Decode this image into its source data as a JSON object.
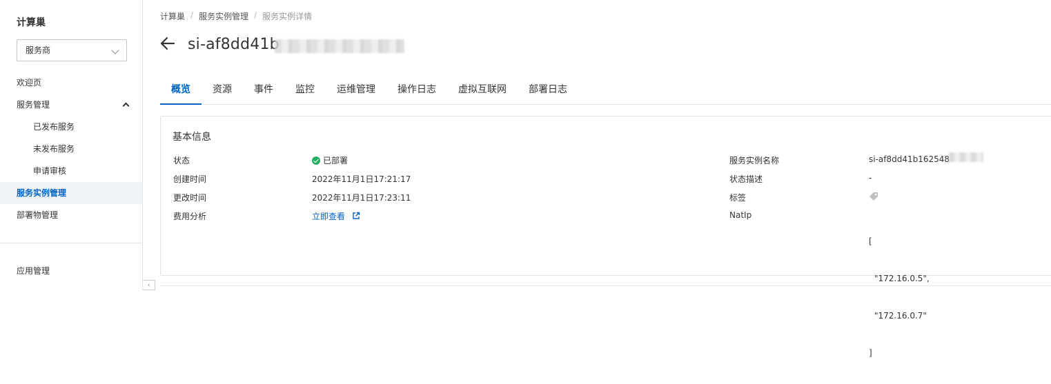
{
  "sidebar": {
    "title": "计算巢",
    "select_value": "服务商",
    "items": [
      {
        "label": "欢迎页"
      },
      {
        "label": "服务管理"
      },
      {
        "label": "已发布服务"
      },
      {
        "label": "未发布服务"
      },
      {
        "label": "申请审核"
      },
      {
        "label": "服务实例管理"
      },
      {
        "label": "部署物管理"
      },
      {
        "label": "应用管理"
      }
    ]
  },
  "breadcrumb": [
    "计算巢",
    "服务实例管理",
    "服务实例详情"
  ],
  "page": {
    "title": "si-af8dd41b"
  },
  "tabs": [
    "概览",
    "资源",
    "事件",
    "监控",
    "运维管理",
    "操作日志",
    "虚拟互联网",
    "部署日志"
  ],
  "panel": {
    "title": "基本信息",
    "left": {
      "status_label": "状态",
      "status_value": "已部署",
      "created_label": "创建时间",
      "created_value": "2022年11月1日17:21:17",
      "updated_label": "更改时间",
      "updated_value": "2022年11月1日17:23:11",
      "cost_label": "费用分析",
      "cost_link": "立即查看"
    },
    "right": {
      "name_label": "服务实例名称",
      "name_value": "si-af8dd41b162548",
      "desc_label": "状态描述",
      "desc_value": "-",
      "tag_label": "标签",
      "natip_label": "NatIp",
      "natip_open": "[",
      "natip_1": "\"172.16.0.5\",",
      "natip_2": "\"172.16.0.7\"",
      "natip_close": "]"
    }
  },
  "colors": {
    "accent": "#0064c8",
    "success": "#23b066"
  }
}
